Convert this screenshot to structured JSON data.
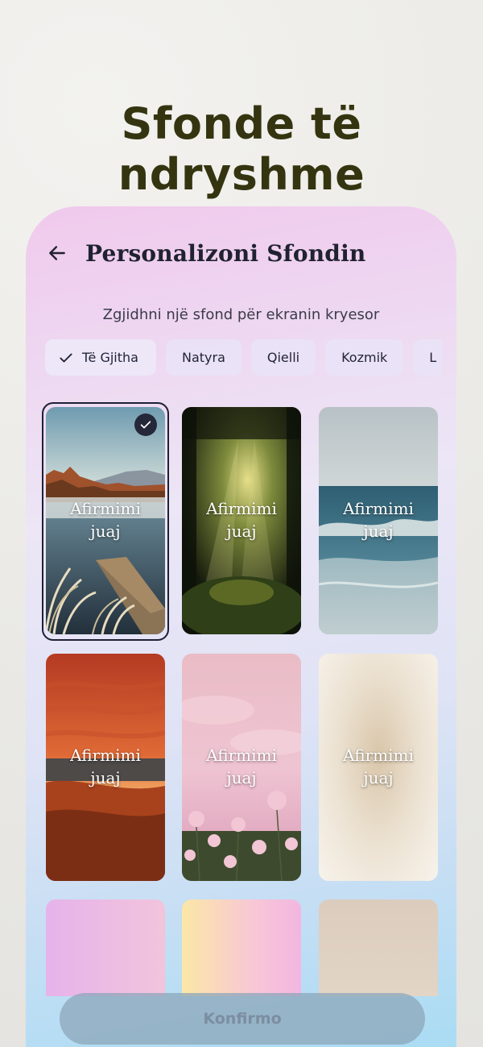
{
  "headline": "Sfonde të ndryshme",
  "screen": {
    "title": "Personalizoni Sfondin",
    "subtitle": "Zgjidhni një sfond për ekranin kryesor",
    "back_icon": "arrow-left-icon"
  },
  "chips": [
    {
      "label": "Të Gjitha",
      "selected": true
    },
    {
      "label": "Natyra",
      "selected": false
    },
    {
      "label": "Qielli",
      "selected": false
    },
    {
      "label": "Kozmik",
      "selected": false
    },
    {
      "label": "L",
      "selected": false
    }
  ],
  "card_text": {
    "line1": "Afirmimi",
    "line2": "juaj"
  },
  "backgrounds": [
    {
      "name": "lake-dock",
      "selected": true
    },
    {
      "name": "forest-sunbeams",
      "selected": false
    },
    {
      "name": "ocean-waves",
      "selected": false
    },
    {
      "name": "sunset-beach",
      "selected": false
    },
    {
      "name": "pink-flowers",
      "selected": false
    },
    {
      "name": "cream-gradient",
      "selected": false
    },
    {
      "name": "pink-gradient",
      "selected": false
    },
    {
      "name": "yellow-pink-gradient",
      "selected": false
    },
    {
      "name": "beige-gradient",
      "selected": false
    }
  ],
  "confirm_label": "Konfirmo",
  "colors": {
    "headline": "#343510",
    "accent_dark": "#252839"
  }
}
